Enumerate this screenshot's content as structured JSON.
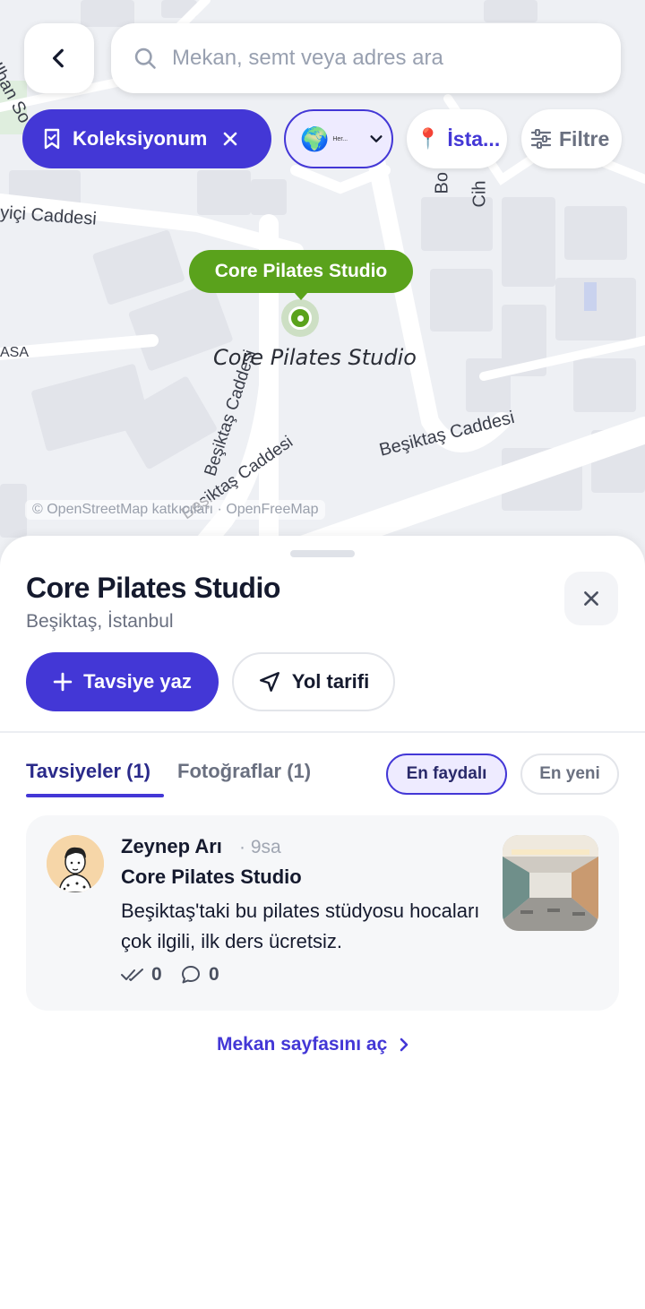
{
  "map": {
    "streets": [
      "yiçi Caddesi",
      "ASA",
      "Beşiktaş Caddesi",
      "Beşiktaş Caddesi",
      "Beşiktaş Caddesi"
    ],
    "top_fragments": [
      "Ilhan So",
      "Bo",
      "Cih"
    ],
    "attribution": "© OpenStreetMap katkıcıları · OpenFreeMap",
    "pin_label": "Core Pilates Studio",
    "place_label": "Core Pilates Studio"
  },
  "topbar": {
    "back_icon": "chevron-left-icon",
    "search_placeholder": "Mekan, semt veya adres ara"
  },
  "chips": {
    "collection": "Koleksiyonum",
    "globe_emoji": "🌍",
    "globe_label": "Her...",
    "city_emoji": "📍",
    "city": "İsta...",
    "filter": "Filtre"
  },
  "sheet": {
    "title": "Core Pilates Studio",
    "subtitle": "Beşiktaş, İstanbul",
    "primary_button": "Tavsiye yaz",
    "secondary_button": "Yol tarifi",
    "tabs": [
      "Tavsiyeler (1)",
      "Fotoğraflar (1)"
    ],
    "sort": [
      "En faydalı",
      "En yeni"
    ],
    "open_link": "Mekan sayfasını aç"
  },
  "review": {
    "author": "Zeynep Arı",
    "time": "· 9sa",
    "place": "Core Pilates Studio",
    "text": "Beşiktaş'taki bu pilates stüdyosu hocaları çok ilgili, ilk ders ücretsiz.",
    "likes": "0",
    "comments": "0"
  },
  "colors": {
    "accent": "#4337d6",
    "pin_green": "#5aa21c",
    "map_bg": "#eef0f4"
  }
}
